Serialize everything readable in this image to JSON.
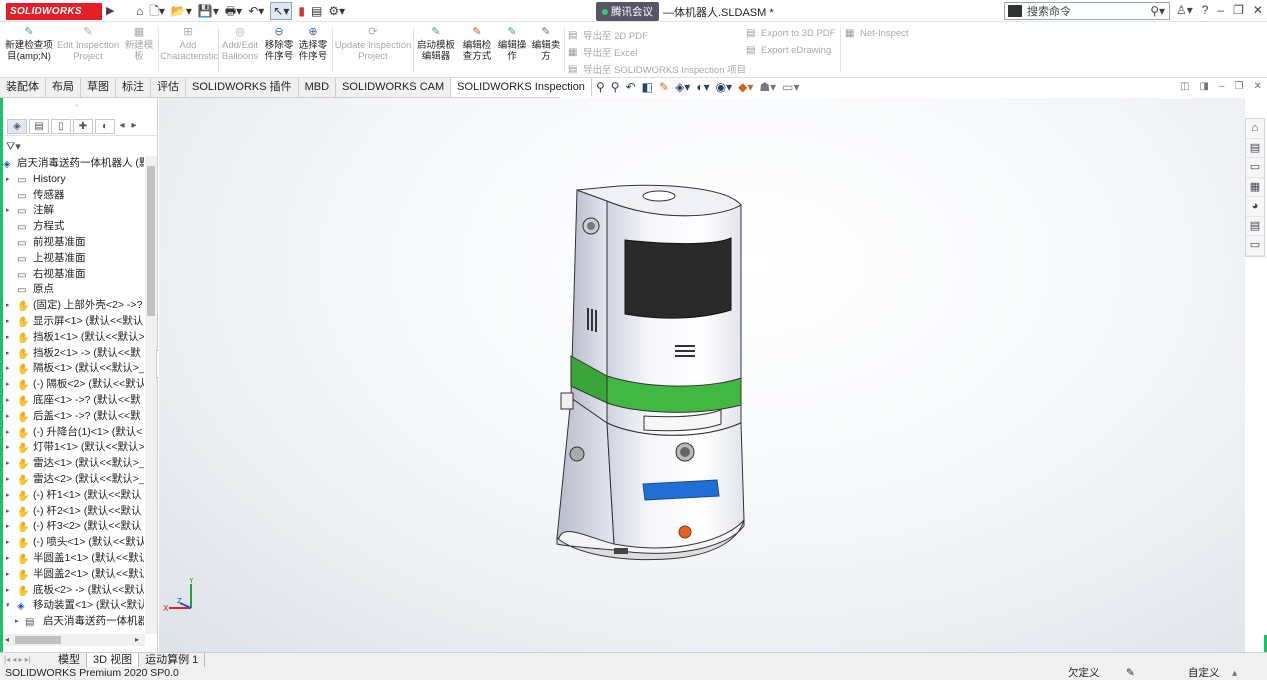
{
  "app": {
    "logo": "SOLIDWORKS",
    "window_title": "—体机器人.SLDASM *",
    "meeting": "腾讯会议"
  },
  "search": {
    "placeholder": "搜索命令"
  },
  "ribbon": {
    "buttons": [
      {
        "label1": "新建检查项",
        "label2": "目(amp;N)"
      },
      {
        "label1": "Edit Inspection",
        "label2": "Project"
      },
      {
        "label1": "新建模",
        "label2": "板"
      },
      {
        "label1": "Add",
        "label2": "Characteristic"
      },
      {
        "label1": "Add/Edit",
        "label2": "Balloons"
      },
      {
        "label1": "移除零",
        "label2": "件序号"
      },
      {
        "label1": "选择零",
        "label2": "件序号"
      },
      {
        "label1": "Update Inspection",
        "label2": "Project"
      },
      {
        "label1": "启动模板",
        "label2": "编辑器"
      },
      {
        "label1": "编辑检",
        "label2": "查方式"
      },
      {
        "label1": "编辑操",
        "label2": "作"
      },
      {
        "label1": "编辑卖",
        "label2": "方"
      }
    ],
    "export": [
      "导出至 2D PDF",
      "导出至 Excel",
      "导出至 SOLIDWORKS Inspection 项目",
      "Export to 3D PDF",
      "Export eDrawing",
      "Net-Inspect"
    ]
  },
  "tabs": [
    "装配体",
    "布局",
    "草图",
    "标注",
    "评估",
    "SOLIDWORKS 插件",
    "MBD",
    "SOLIDWORKS CAM",
    "SOLIDWORKS Inspection"
  ],
  "tree": [
    {
      "text": "启天消毒送药一体机器人 (默",
      "type": "root"
    },
    {
      "text": "History"
    },
    {
      "text": "传感器"
    },
    {
      "text": "注解"
    },
    {
      "text": "方程式"
    },
    {
      "text": "前视基准面"
    },
    {
      "text": "上视基准面"
    },
    {
      "text": "右视基准面"
    },
    {
      "text": "原点"
    },
    {
      "text": "(固定) 上部外壳<2> ->?"
    },
    {
      "text": "显示屏<1> (默认<<默认>"
    },
    {
      "text": "挡板1<1> (默认<<默认>"
    },
    {
      "text": "挡板2<1> -> (默认<<默"
    },
    {
      "text": "隔板<1> (默认<<默认>_"
    },
    {
      "text": "(-) 隔板<2> (默认<<默认"
    },
    {
      "text": "底座<1> ->? (默认<<默"
    },
    {
      "text": "后盖<1> ->? (默认<<默"
    },
    {
      "text": "(-) 升降台(1)<1> (默认<"
    },
    {
      "text": "灯带1<1> (默认<<默认>"
    },
    {
      "text": "雷达<1> (默认<<默认>_"
    },
    {
      "text": "雷达<2> (默认<<默认>_"
    },
    {
      "text": "(-) 杆1<1> (默认<<默认"
    },
    {
      "text": "(-) 杆2<1> (默认<<默认"
    },
    {
      "text": "(-) 杆3<2> (默认<<默认"
    },
    {
      "text": "(-) 喷头<1> (默认<<默认"
    },
    {
      "text": "半圆盖1<1> (默认<<默认"
    },
    {
      "text": "半圆盖2<1> (默认<<默认"
    },
    {
      "text": "底板<2> -> (默认<<默认"
    },
    {
      "text": "移动装置<1> (默认<默认"
    },
    {
      "text": "启天消毒送药一体机器",
      "type": "sub"
    }
  ],
  "bottom_tabs": [
    "模型",
    "3D 视图",
    "运动算例 1"
  ],
  "status": {
    "version": "SOLIDWORKS Premium 2020 SP0.0",
    "underdefined": "欠定义",
    "custom": "自定义"
  },
  "triad": {
    "y": "Y",
    "x": "X",
    "z": "Z"
  },
  "colors": {
    "brand": "#e41e26",
    "accent_green": "#1cc26b",
    "model_green": "#3cb43c",
    "model_blue": "#1f6fd6"
  }
}
